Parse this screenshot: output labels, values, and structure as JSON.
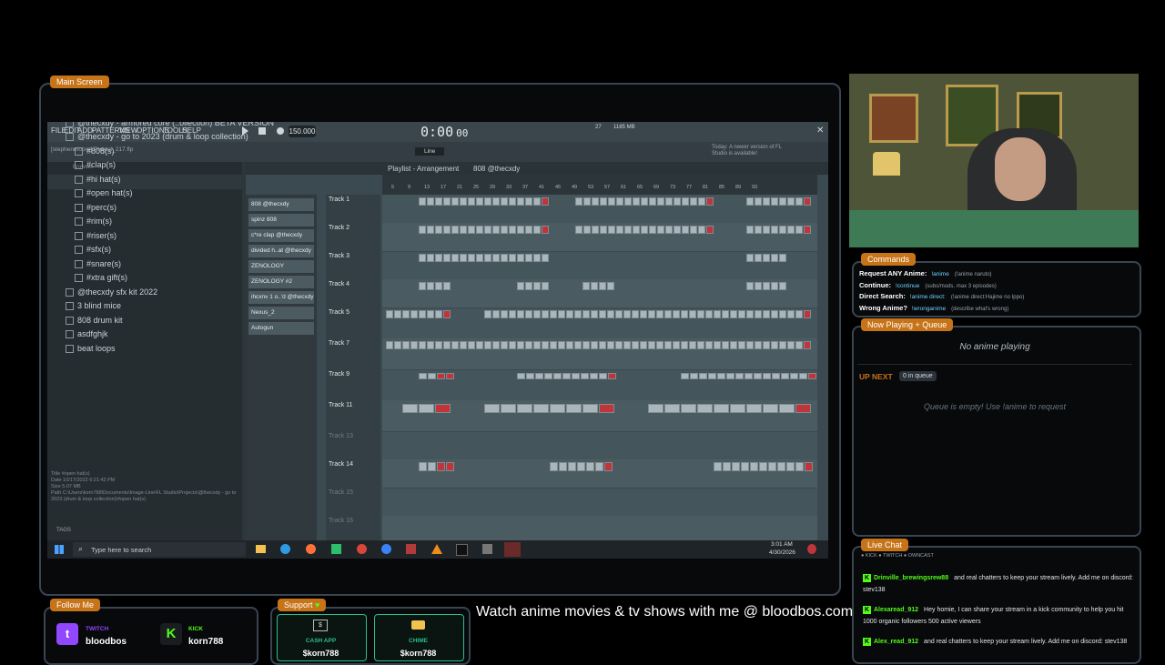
{
  "main_screen_tag": "Main Screen",
  "fl": {
    "menu": [
      "FILE",
      "EDIT",
      "ADD",
      "PATTERNS",
      "VIEW",
      "OPTIONS",
      "TOOLS",
      "HELP"
    ],
    "tempo": "150.000",
    "time": "0:00",
    "time_ms": "00",
    "memory": "1185 MB",
    "cpu": "27",
    "project": "[stephenmoore] Project_217.flp",
    "hint": "Today: A newer version of FL Studio is available!",
    "playlist_title": "Playlist - Arrangement",
    "playlist_pattern": "808 @thecxdy",
    "snap": "Line",
    "tool_label": "Browser",
    "browser_items": [
      "l Cxdy - Go To 2021 2.0 (Producer Kit)",
      "$umeenk Drum Kit Vol. 1",
      "@thecxdy - armored core (..ollection) BETA VERSION",
      "@thecxdy - go to 2023 (drum & loop collection)",
      "#808(s)",
      "#clap(s)",
      "#hi hat(s)",
      "#open hat(s)",
      "#perc(s)",
      "#rim(s)",
      "#riser(s)",
      "#sfx(s)",
      "#snare(s)",
      "#xtra gift(s)",
      "@thecxdy sfx kit 2022",
      "3 blind mice",
      "808 drum kit",
      "asdfghjk",
      "beat loops"
    ],
    "info": {
      "title": "#open hat(s)",
      "date": "10/17/2022 6:21:42 PM",
      "size": "5.07 MB",
      "path": "C:\\Users\\korn788\\Documents\\Image-Line\\FL Studio\\Projects\\@thecxdy - go to 2023 (drum & loop collection)\\#open hat(s)"
    },
    "tags_label": "TAGS",
    "channels": [
      "808 @thecxdy",
      "spinz 808",
      "c*re clap @thecxdy",
      "divided h..at @thecxdy",
      "ZENOLOGY",
      "ZENOLOGY #2",
      "ihcxnv 1 o..'d @thecxdy",
      "Nexus_2",
      "Autogun"
    ],
    "tracks": [
      "Track 1",
      "Track 2",
      "Track 3",
      "Track 4",
      "Track 5",
      "Track 7",
      "Track 9",
      "Track 11",
      "Track 13",
      "Track 14",
      "Track 15",
      "Track 16"
    ],
    "ruler": [
      "5",
      "9",
      "13",
      "17",
      "21",
      "25",
      "29",
      "33",
      "37",
      "41",
      "45",
      "49",
      "53",
      "57",
      "61",
      "65",
      "69",
      "73",
      "77",
      "81",
      "85",
      "89",
      "93"
    ],
    "taskbar_search": "Type here to search",
    "clock_time": "3:01 AM",
    "clock_date": "4/30/2026"
  },
  "commands": {
    "tag": "Commands",
    "lines": [
      {
        "label": "Request ANY Anime:",
        "cmd": "!anime",
        "desc": "(!anime naruto)"
      },
      {
        "label": "Continue:",
        "cmd": "!continue",
        "desc": "(subs/mods, max 3 episodes)"
      },
      {
        "label": "Direct Search:",
        "cmd": "!anime direct:",
        "desc": "(!anime direct:Hajime no Ippo)"
      },
      {
        "label": "Wrong Anime?",
        "cmd": "!wronganime",
        "desc": "(describe what's wrong)"
      }
    ]
  },
  "queue": {
    "tag": "Now Playing + Queue",
    "now_playing": "No anime playing",
    "up_next": "UP NEXT",
    "count": "0 in queue",
    "empty": "Queue is empty! Use !anime to request"
  },
  "chat": {
    "tag": "Live Chat",
    "sources": "● KICK ● TWITCH ● OWNCAST",
    "messages": [
      {
        "user": "Drinville_brewingsrew88",
        "text": "and real chatters to keep your stream lively. Add me on discord: stev138"
      },
      {
        "user": "Alexaread_912",
        "text": "Hey homie, I can share your stream in a kick community to help you hit 1000 organic followers 500 active viewers"
      },
      {
        "user": "Alex_read_912",
        "text": "and real chatters to keep your stream lively. Add me on discord: stev138"
      }
    ]
  },
  "follow": {
    "tag": "Follow Me",
    "twitch_label": "TWITCH",
    "twitch_name": "bloodbos",
    "kick_label": "KICK",
    "kick_name": "korn788"
  },
  "support": {
    "tag": "Support",
    "cashapp_label": "CASH APP",
    "cashapp_handle": "$korn788",
    "chime_label": "CHIME",
    "chime_handle": "$korn788"
  },
  "ticker": "Watch anime movies & tv shows with me @ bloodbos.com",
  "colors": {
    "accent": "#c77318",
    "kick": "#53fc18",
    "twitch": "#9146ff",
    "clip_red": "#c0343a"
  }
}
